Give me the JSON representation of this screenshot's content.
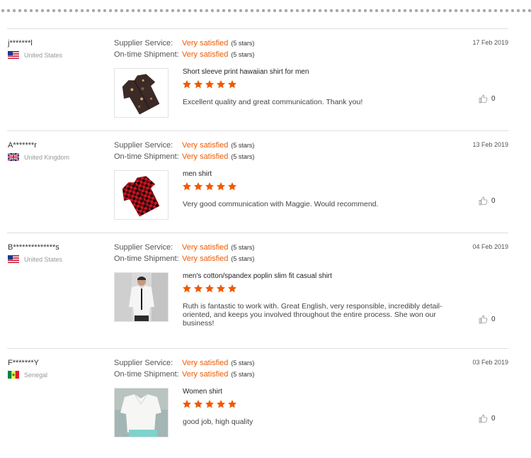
{
  "labels": {
    "supplier_service": "Supplier Service:",
    "ontime_shipment": "On-time Shipment:"
  },
  "colors": {
    "accent": "#f05a00",
    "star": "#f05a00"
  },
  "reviews": [
    {
      "user": "j*******l",
      "country": "United States",
      "flag": "us-flag-icon",
      "date": "17 Feb 2019",
      "supplier_rating": "Very satisfied",
      "supplier_stars": "(5 stars)",
      "shipment_rating": "Very satisfied",
      "shipment_stars": "(5 stars)",
      "product": "Short sleeve print hawaiian shirt for men",
      "stars": 5,
      "comment": "Excellent quality and great communication. Thank you!",
      "likes": "0"
    },
    {
      "user": "A*******r",
      "country": "United Kingdom",
      "flag": "uk-flag-icon",
      "date": "13 Feb 2019",
      "supplier_rating": "Very satisfied",
      "supplier_stars": "(5 stars)",
      "shipment_rating": "Very satisfied",
      "shipment_stars": "(5 stars)",
      "product": "men shirt",
      "stars": 5,
      "comment": "Very good communication with Maggie. Would recommend.",
      "likes": "0"
    },
    {
      "user": "B**************s",
      "country": "United States",
      "flag": "us-flag-icon",
      "date": "04 Feb 2019",
      "supplier_rating": "Very satisfied",
      "supplier_stars": "(5 stars)",
      "shipment_rating": "Very satisfied",
      "shipment_stars": "(5 stars)",
      "product": "men's cotton/spandex poplin slim fit casual shirt",
      "stars": 5,
      "comment": "Ruth is fantastic to work with. Great English, very responsible, incredibly detail-oriented, and keeps you involved throughout the entire process. She won our business!",
      "likes": "0"
    },
    {
      "user": "F*******Y",
      "country": "Senegal",
      "flag": "senegal-flag-icon",
      "date": "03 Feb 2019",
      "supplier_rating": "Very satisfied",
      "supplier_stars": "(5 stars)",
      "shipment_rating": "Very satisfied",
      "shipment_stars": "(5 stars)",
      "product": "Women shirt",
      "stars": 5,
      "comment": "good job, high quality",
      "likes": "0"
    }
  ]
}
